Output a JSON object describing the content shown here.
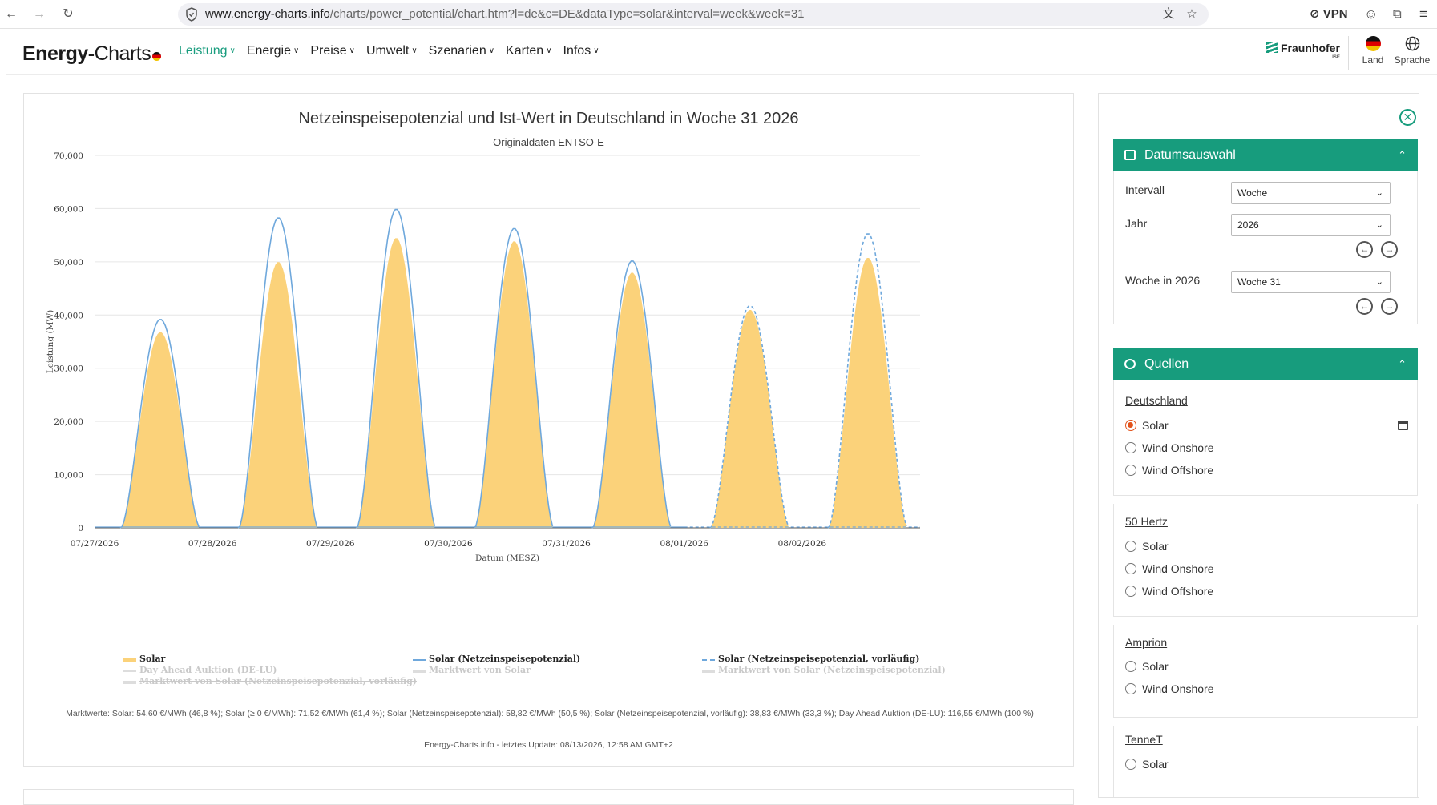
{
  "browser": {
    "url_domain": "www.energy-charts.info",
    "url_path": "/charts/power_potential/chart.htm?l=de&c=DE&dataType=solar&interval=week&week=31",
    "vpn_label": "VPN"
  },
  "header": {
    "logo_main": "Energy-",
    "logo_script": "Charts",
    "menu": [
      {
        "label": "Leistung",
        "active": true
      },
      {
        "label": "Energie"
      },
      {
        "label": "Preise"
      },
      {
        "label": "Umwelt"
      },
      {
        "label": "Szenarien"
      },
      {
        "label": "Karten"
      },
      {
        "label": "Infos"
      }
    ],
    "brand": "Fraunhofer",
    "brand_sub": "ISE",
    "land_label": "Land",
    "sprache_label": "Sprache"
  },
  "chart_data": {
    "type": "area",
    "title": "Netzeinspeisepotenzial und Ist-Wert in Deutschland in Woche 31 2026",
    "subtitle": "Originaldaten ENTSO-E",
    "xlabel": "Datum (MESZ)",
    "ylabel": "Leistung (MW)",
    "ylim": [
      0,
      70000
    ],
    "yticks": [
      "0",
      "10,000",
      "20,000",
      "30,000",
      "40,000",
      "50,000",
      "60,000",
      "70,000"
    ],
    "x": [
      "07/27/2026",
      "07/28/2026",
      "07/29/2026",
      "07/30/2026",
      "07/31/2026",
      "08/01/2026",
      "08/02/2026"
    ],
    "grid": true,
    "legend_position": "bottom",
    "series": [
      {
        "name": "Solar",
        "style": "area",
        "color": "#fbd27a",
        "values": [
          36800,
          50000,
          54500,
          53900,
          48000,
          41000,
          50800
        ]
      },
      {
        "name": "Solar (Netzeinspeisepotenzial)",
        "style": "line",
        "color": "#6fa8dc",
        "values": [
          39200,
          58300,
          59900,
          56300,
          50200,
          null,
          null
        ]
      },
      {
        "name": "Solar (Netzeinspeisepotenzial, vorläufig)",
        "style": "dashed",
        "color": "#6fa8dc",
        "values": [
          null,
          null,
          null,
          null,
          null,
          41800,
          55300
        ]
      }
    ],
    "hidden_series": [
      "Day Ahead Auktion (DE-LU)",
      "Marktwert von Solar",
      "Marktwert von Solar (Netzeinspeisepotenzial)",
      "Marktwert von Solar (Netzeinspeisepotenzial, vorläufig)"
    ]
  },
  "footer": {
    "marktwerte": "Marktwerte: Solar: 54,60 €/MWh (46,8 %); Solar (≥ 0 €/MWh): 71,52 €/MWh (61,4 %); Solar (Netzeinspeisepotenzial): 58,82 €/MWh (50,5 %); Solar (Netzeinspeisepotenzial, vorläufig): 38,83 €/MWh (33,3 %); Day Ahead Auktion (DE-LU): 116,55 €/MWh (100 %)",
    "update": "Energy-Charts.info - letztes Update: 08/13/2026, 12:58 AM GMT+2"
  },
  "panel": {
    "datum_title": "Datumsauswahl",
    "intervall_label": "Intervall",
    "intervall_value": "Woche",
    "jahr_label": "Jahr",
    "jahr_value": "2026",
    "woche_label": "Woche in 2026",
    "woche_value": "Woche 31",
    "quellen_title": "Quellen",
    "groups": [
      {
        "title": "Deutschland",
        "options": [
          "Solar",
          "Wind Onshore",
          "Wind Offshore"
        ],
        "selected": 0
      },
      {
        "title": "50 Hertz",
        "options": [
          "Solar",
          "Wind Onshore",
          "Wind Offshore"
        ]
      },
      {
        "title": "Amprion",
        "options": [
          "Solar",
          "Wind Onshore"
        ]
      },
      {
        "title": "TenneT",
        "options": [
          "Solar"
        ]
      }
    ]
  }
}
